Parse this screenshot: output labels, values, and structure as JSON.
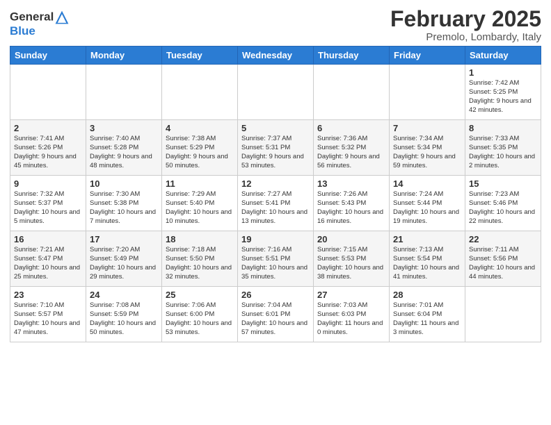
{
  "logo": {
    "general": "General",
    "blue": "Blue"
  },
  "title": "February 2025",
  "subtitle": "Premolo, Lombardy, Italy",
  "days_of_week": [
    "Sunday",
    "Monday",
    "Tuesday",
    "Wednesday",
    "Thursday",
    "Friday",
    "Saturday"
  ],
  "weeks": [
    [
      {
        "day": "",
        "info": ""
      },
      {
        "day": "",
        "info": ""
      },
      {
        "day": "",
        "info": ""
      },
      {
        "day": "",
        "info": ""
      },
      {
        "day": "",
        "info": ""
      },
      {
        "day": "",
        "info": ""
      },
      {
        "day": "1",
        "info": "Sunrise: 7:42 AM\nSunset: 5:25 PM\nDaylight: 9 hours and 42 minutes."
      }
    ],
    [
      {
        "day": "2",
        "info": "Sunrise: 7:41 AM\nSunset: 5:26 PM\nDaylight: 9 hours and 45 minutes."
      },
      {
        "day": "3",
        "info": "Sunrise: 7:40 AM\nSunset: 5:28 PM\nDaylight: 9 hours and 48 minutes."
      },
      {
        "day": "4",
        "info": "Sunrise: 7:38 AM\nSunset: 5:29 PM\nDaylight: 9 hours and 50 minutes."
      },
      {
        "day": "5",
        "info": "Sunrise: 7:37 AM\nSunset: 5:31 PM\nDaylight: 9 hours and 53 minutes."
      },
      {
        "day": "6",
        "info": "Sunrise: 7:36 AM\nSunset: 5:32 PM\nDaylight: 9 hours and 56 minutes."
      },
      {
        "day": "7",
        "info": "Sunrise: 7:34 AM\nSunset: 5:34 PM\nDaylight: 9 hours and 59 minutes."
      },
      {
        "day": "8",
        "info": "Sunrise: 7:33 AM\nSunset: 5:35 PM\nDaylight: 10 hours and 2 minutes."
      }
    ],
    [
      {
        "day": "9",
        "info": "Sunrise: 7:32 AM\nSunset: 5:37 PM\nDaylight: 10 hours and 5 minutes."
      },
      {
        "day": "10",
        "info": "Sunrise: 7:30 AM\nSunset: 5:38 PM\nDaylight: 10 hours and 7 minutes."
      },
      {
        "day": "11",
        "info": "Sunrise: 7:29 AM\nSunset: 5:40 PM\nDaylight: 10 hours and 10 minutes."
      },
      {
        "day": "12",
        "info": "Sunrise: 7:27 AM\nSunset: 5:41 PM\nDaylight: 10 hours and 13 minutes."
      },
      {
        "day": "13",
        "info": "Sunrise: 7:26 AM\nSunset: 5:43 PM\nDaylight: 10 hours and 16 minutes."
      },
      {
        "day": "14",
        "info": "Sunrise: 7:24 AM\nSunset: 5:44 PM\nDaylight: 10 hours and 19 minutes."
      },
      {
        "day": "15",
        "info": "Sunrise: 7:23 AM\nSunset: 5:46 PM\nDaylight: 10 hours and 22 minutes."
      }
    ],
    [
      {
        "day": "16",
        "info": "Sunrise: 7:21 AM\nSunset: 5:47 PM\nDaylight: 10 hours and 25 minutes."
      },
      {
        "day": "17",
        "info": "Sunrise: 7:20 AM\nSunset: 5:49 PM\nDaylight: 10 hours and 29 minutes."
      },
      {
        "day": "18",
        "info": "Sunrise: 7:18 AM\nSunset: 5:50 PM\nDaylight: 10 hours and 32 minutes."
      },
      {
        "day": "19",
        "info": "Sunrise: 7:16 AM\nSunset: 5:51 PM\nDaylight: 10 hours and 35 minutes."
      },
      {
        "day": "20",
        "info": "Sunrise: 7:15 AM\nSunset: 5:53 PM\nDaylight: 10 hours and 38 minutes."
      },
      {
        "day": "21",
        "info": "Sunrise: 7:13 AM\nSunset: 5:54 PM\nDaylight: 10 hours and 41 minutes."
      },
      {
        "day": "22",
        "info": "Sunrise: 7:11 AM\nSunset: 5:56 PM\nDaylight: 10 hours and 44 minutes."
      }
    ],
    [
      {
        "day": "23",
        "info": "Sunrise: 7:10 AM\nSunset: 5:57 PM\nDaylight: 10 hours and 47 minutes."
      },
      {
        "day": "24",
        "info": "Sunrise: 7:08 AM\nSunset: 5:59 PM\nDaylight: 10 hours and 50 minutes."
      },
      {
        "day": "25",
        "info": "Sunrise: 7:06 AM\nSunset: 6:00 PM\nDaylight: 10 hours and 53 minutes."
      },
      {
        "day": "26",
        "info": "Sunrise: 7:04 AM\nSunset: 6:01 PM\nDaylight: 10 hours and 57 minutes."
      },
      {
        "day": "27",
        "info": "Sunrise: 7:03 AM\nSunset: 6:03 PM\nDaylight: 11 hours and 0 minutes."
      },
      {
        "day": "28",
        "info": "Sunrise: 7:01 AM\nSunset: 6:04 PM\nDaylight: 11 hours and 3 minutes."
      },
      {
        "day": "",
        "info": ""
      }
    ]
  ]
}
